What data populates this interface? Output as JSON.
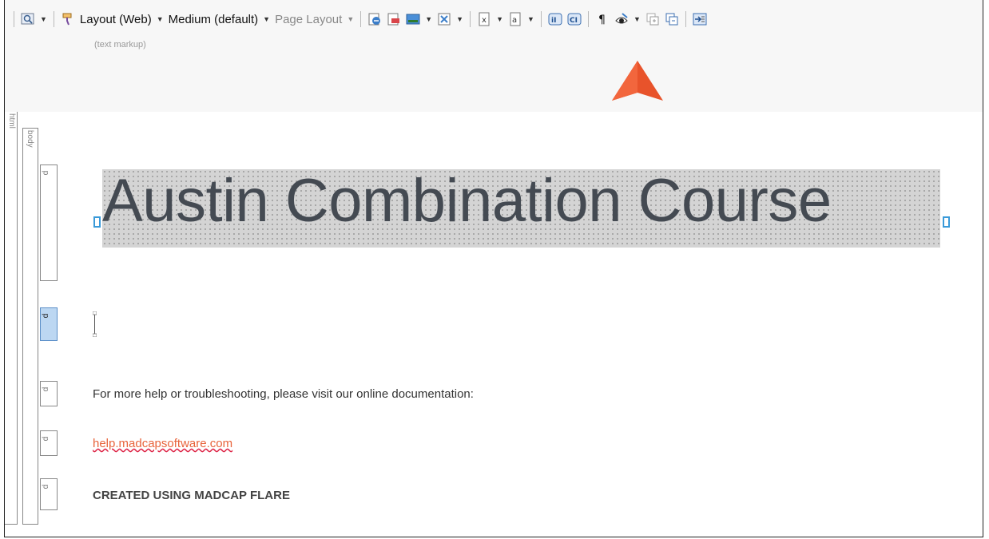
{
  "toolbar": {
    "layout_label": "Layout (Web)",
    "medium_label": "Medium (default)",
    "page_layout_label": "Page Layout"
  },
  "markup": {
    "label": "(text markup)"
  },
  "structure_bars": {
    "html_label": "html",
    "body_label": "body",
    "p_label": "p"
  },
  "document": {
    "heading": "Austin Combination Course",
    "help_text": "For more help or troubleshooting, please visit our online documentation:",
    "link_text": "help.madcapsoftware.com",
    "footer_text": "CREATED USING MADCAP FLARE"
  },
  "colors": {
    "accent_arrow": "#e8532b",
    "link": "#e8633a",
    "selection_handle": "#3a9ad9"
  }
}
